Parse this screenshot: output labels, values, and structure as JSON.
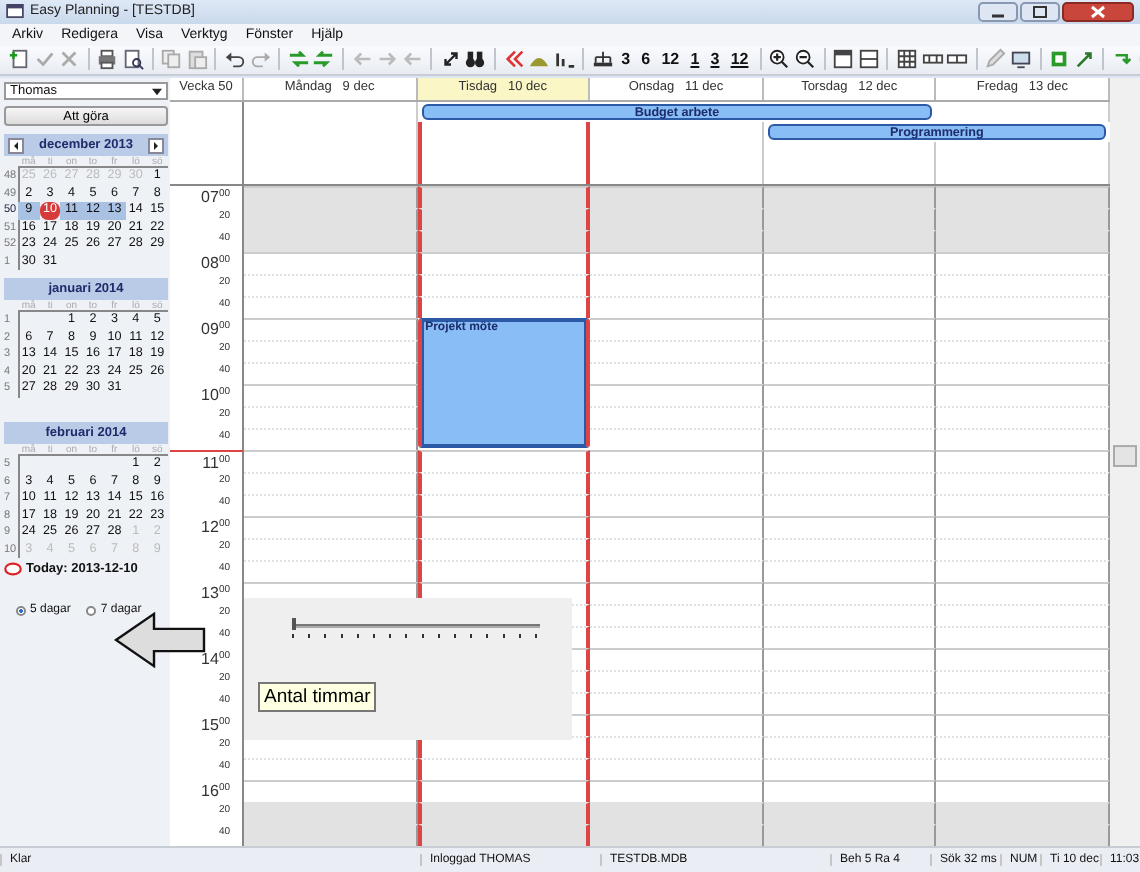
{
  "window": {
    "title": "Easy Planning - [TESTDB]"
  },
  "menu": [
    "Arkiv",
    "Redigera",
    "Visa",
    "Verktyg",
    "Fönster",
    "Hjälp"
  ],
  "toolbar": {
    "text_buttons": [
      {
        "label": "3",
        "underlined": false
      },
      {
        "label": "6",
        "underlined": false
      },
      {
        "label": "12",
        "underlined": false
      },
      {
        "label": "1",
        "underlined": true
      },
      {
        "label": "3",
        "underlined": true
      },
      {
        "label": "12",
        "underlined": true
      }
    ]
  },
  "sidebar": {
    "user": "Thomas",
    "todo_button": "Att göra",
    "months": [
      {
        "title": "december 2013",
        "navigation": true,
        "weekdays": [
          "må",
          "ti",
          "on",
          "to",
          "fr",
          "lö",
          "sö"
        ],
        "weeks": [
          {
            "number": "48",
            "selected": false,
            "days": [
              {
                "label": "25",
                "outside": true,
                "today": false
              },
              {
                "label": "26",
                "outside": true,
                "today": false
              },
              {
                "label": "27",
                "outside": true,
                "today": false
              },
              {
                "label": "28",
                "outside": true,
                "today": false
              },
              {
                "label": "29",
                "outside": true,
                "today": false
              },
              {
                "label": "30",
                "outside": true,
                "today": false
              },
              {
                "label": "1",
                "outside": false,
                "today": false
              }
            ]
          },
          {
            "number": "49",
            "selected": false,
            "days": [
              {
                "label": "2",
                "outside": false,
                "today": false
              },
              {
                "label": "3",
                "outside": false,
                "today": false
              },
              {
                "label": "4",
                "outside": false,
                "today": false
              },
              {
                "label": "5",
                "outside": false,
                "today": false
              },
              {
                "label": "6",
                "outside": false,
                "today": false
              },
              {
                "label": "7",
                "outside": false,
                "today": false
              },
              {
                "label": "8",
                "outside": false,
                "today": false
              }
            ]
          },
          {
            "number": "50",
            "selected": true,
            "days": [
              {
                "label": "9",
                "outside": false,
                "today": false
              },
              {
                "label": "10",
                "outside": false,
                "today": true
              },
              {
                "label": "11",
                "outside": false,
                "today": false
              },
              {
                "label": "12",
                "outside": false,
                "today": false
              },
              {
                "label": "13",
                "outside": false,
                "today": false
              },
              {
                "label": "14",
                "outside": false,
                "today": false
              },
              {
                "label": "15",
                "outside": false,
                "today": false
              }
            ]
          },
          {
            "number": "51",
            "selected": false,
            "days": [
              {
                "label": "16",
                "outside": false,
                "today": false
              },
              {
                "label": "17",
                "outside": false,
                "today": false
              },
              {
                "label": "18",
                "outside": false,
                "today": false
              },
              {
                "label": "19",
                "outside": false,
                "today": false
              },
              {
                "label": "20",
                "outside": false,
                "today": false
              },
              {
                "label": "21",
                "outside": false,
                "today": false
              },
              {
                "label": "22",
                "outside": false,
                "today": false
              }
            ]
          },
          {
            "number": "52",
            "selected": false,
            "days": [
              {
                "label": "23",
                "outside": false,
                "today": false
              },
              {
                "label": "24",
                "outside": false,
                "today": false
              },
              {
                "label": "25",
                "outside": false,
                "today": false
              },
              {
                "label": "26",
                "outside": false,
                "today": false
              },
              {
                "label": "27",
                "outside": false,
                "today": false
              },
              {
                "label": "28",
                "outside": false,
                "today": false
              },
              {
                "label": "29",
                "outside": false,
                "today": false
              }
            ]
          },
          {
            "number": "1",
            "selected": false,
            "days": [
              {
                "label": "30",
                "outside": false,
                "today": false
              },
              {
                "label": "31",
                "outside": false,
                "today": false
              }
            ]
          }
        ]
      },
      {
        "title": "januari 2014",
        "navigation": false,
        "weekdays": [
          "må",
          "ti",
          "on",
          "to",
          "fr",
          "lö",
          "sö"
        ],
        "weeks": [
          {
            "number": "1",
            "selected": false,
            "days": [
              {
                "label": "1",
                "outside": false,
                "today": false
              },
              {
                "label": "2",
                "outside": false,
                "today": false
              },
              {
                "label": "3",
                "outside": false,
                "today": false
              },
              {
                "label": "4",
                "outside": false,
                "today": false
              },
              {
                "label": "5",
                "outside": false,
                "today": false
              }
            ]
          },
          {
            "number": "2",
            "selected": false,
            "days": [
              {
                "label": "6",
                "outside": false,
                "today": false
              },
              {
                "label": "7",
                "outside": false,
                "today": false
              },
              {
                "label": "8",
                "outside": false,
                "today": false
              },
              {
                "label": "9",
                "outside": false,
                "today": false
              },
              {
                "label": "10",
                "outside": false,
                "today": false
              },
              {
                "label": "11",
                "outside": false,
                "today": false
              },
              {
                "label": "12",
                "outside": false,
                "today": false
              }
            ]
          },
          {
            "number": "3",
            "selected": false,
            "days": [
              {
                "label": "13",
                "outside": false,
                "today": false
              },
              {
                "label": "14",
                "outside": false,
                "today": false
              },
              {
                "label": "15",
                "outside": false,
                "today": false
              },
              {
                "label": "16",
                "outside": false,
                "today": false
              },
              {
                "label": "17",
                "outside": false,
                "today": false
              },
              {
                "label": "18",
                "outside": false,
                "today": false
              },
              {
                "label": "19",
                "outside": false,
                "today": false
              }
            ]
          },
          {
            "number": "4",
            "selected": false,
            "days": [
              {
                "label": "20",
                "outside": false,
                "today": false
              },
              {
                "label": "21",
                "outside": false,
                "today": false
              },
              {
                "label": "22",
                "outside": false,
                "today": false
              },
              {
                "label": "23",
                "outside": false,
                "today": false
              },
              {
                "label": "24",
                "outside": false,
                "today": false
              },
              {
                "label": "25",
                "outside": false,
                "today": false
              },
              {
                "label": "26",
                "outside": false,
                "today": false
              }
            ]
          },
          {
            "number": "5",
            "selected": false,
            "days": [
              {
                "label": "27",
                "outside": false,
                "today": false
              },
              {
                "label": "28",
                "outside": false,
                "today": false
              },
              {
                "label": "29",
                "outside": false,
                "today": false
              },
              {
                "label": "30",
                "outside": false,
                "today": false
              },
              {
                "label": "31",
                "outside": false,
                "today": false
              }
            ]
          }
        ]
      },
      {
        "title": "februari 2014",
        "navigation": false,
        "weekdays": [
          "må",
          "ti",
          "on",
          "to",
          "fr",
          "lö",
          "sö"
        ],
        "weeks": [
          {
            "number": "5",
            "selected": false,
            "days": [
              {
                "label": "1",
                "outside": false,
                "today": false
              },
              {
                "label": "2",
                "outside": false,
                "today": false
              }
            ]
          },
          {
            "number": "6",
            "selected": false,
            "days": [
              {
                "label": "3",
                "outside": false,
                "today": false
              },
              {
                "label": "4",
                "outside": false,
                "today": false
              },
              {
                "label": "5",
                "outside": false,
                "today": false
              },
              {
                "label": "6",
                "outside": false,
                "today": false
              },
              {
                "label": "7",
                "outside": false,
                "today": false
              },
              {
                "label": "8",
                "outside": false,
                "today": false
              },
              {
                "label": "9",
                "outside": false,
                "today": false
              }
            ]
          },
          {
            "number": "7",
            "selected": false,
            "days": [
              {
                "label": "10",
                "outside": false,
                "today": false
              },
              {
                "label": "11",
                "outside": false,
                "today": false
              },
              {
                "label": "12",
                "outside": false,
                "today": false
              },
              {
                "label": "13",
                "outside": false,
                "today": false
              },
              {
                "label": "14",
                "outside": false,
                "today": false
              },
              {
                "label": "15",
                "outside": false,
                "today": false
              },
              {
                "label": "16",
                "outside": false,
                "today": false
              }
            ]
          },
          {
            "number": "8",
            "selected": false,
            "days": [
              {
                "label": "17",
                "outside": false,
                "today": false
              },
              {
                "label": "18",
                "outside": false,
                "today": false
              },
              {
                "label": "19",
                "outside": false,
                "today": false
              },
              {
                "label": "20",
                "outside": false,
                "today": false
              },
              {
                "label": "21",
                "outside": false,
                "today": false
              },
              {
                "label": "22",
                "outside": false,
                "today": false
              },
              {
                "label": "23",
                "outside": false,
                "today": false
              }
            ]
          },
          {
            "number": "9",
            "selected": false,
            "days": [
              {
                "label": "24",
                "outside": false,
                "today": false
              },
              {
                "label": "25",
                "outside": false,
                "today": false
              },
              {
                "label": "26",
                "outside": false,
                "today": false
              },
              {
                "label": "27",
                "outside": false,
                "today": false
              },
              {
                "label": "28",
                "outside": false,
                "today": false
              },
              {
                "label": "1",
                "outside": true,
                "today": false
              },
              {
                "label": "2",
                "outside": true,
                "today": false
              }
            ]
          },
          {
            "number": "10",
            "selected": false,
            "days": [
              {
                "label": "3",
                "outside": true,
                "today": false
              },
              {
                "label": "4",
                "outside": true,
                "today": false
              },
              {
                "label": "5",
                "outside": true,
                "today": false
              },
              {
                "label": "6",
                "outside": true,
                "today": false
              },
              {
                "label": "7",
                "outside": true,
                "today": false
              },
              {
                "label": "8",
                "outside": true,
                "today": false
              },
              {
                "label": "9",
                "outside": true,
                "today": false
              }
            ]
          }
        ]
      }
    ],
    "today_label": "Today: 2013-12-10",
    "view_options": [
      {
        "label": "5 dagar",
        "selected": true
      },
      {
        "label": "7 dagar",
        "selected": false
      }
    ]
  },
  "calendar": {
    "week_label": "Vecka 50",
    "days": [
      {
        "name": "Måndag",
        "date": "9 dec",
        "selected": false,
        "today": false
      },
      {
        "name": "Tisdag",
        "date": "10 dec",
        "selected": true,
        "today": true,
        "events": [
          {
            "title": "Projekt möte"
          }
        ]
      },
      {
        "name": "Onsdag",
        "date": "11 dec",
        "selected": false,
        "today": false
      },
      {
        "name": "Torsdag",
        "date": "12 dec",
        "selected": false,
        "today": false
      },
      {
        "name": "Fredag",
        "date": "13 dec",
        "selected": false,
        "today": false
      }
    ],
    "all_day_events": [
      {
        "title": "Budget arbete",
        "days": [
          false,
          true,
          true,
          true,
          false
        ]
      },
      {
        "title": "Programmering",
        "days": [
          false,
          false,
          false,
          true,
          true
        ]
      }
    ],
    "time_rows": [
      {
        "hour": "07",
        "minute": "00",
        "off_hours": true,
        "now": false,
        "booked": [
          false,
          false,
          false,
          false,
          false
        ]
      },
      {
        "minute": "20",
        "off_hours": true,
        "now": false,
        "booked": [
          false,
          false,
          false,
          false,
          false
        ]
      },
      {
        "minute": "40",
        "off_hours": true,
        "now": false,
        "booked": [
          false,
          false,
          false,
          false,
          false
        ]
      },
      {
        "hour": "08",
        "minute": "00",
        "off_hours": false,
        "now": false,
        "booked": [
          false,
          false,
          false,
          false,
          false
        ]
      },
      {
        "minute": "20",
        "off_hours": false,
        "now": false,
        "booked": [
          false,
          false,
          false,
          false,
          false
        ]
      },
      {
        "minute": "40",
        "off_hours": false,
        "now": false,
        "booked": [
          false,
          false,
          false,
          false,
          false
        ]
      },
      {
        "hour": "09",
        "minute": "00",
        "off_hours": false,
        "now": false,
        "booked": [
          false,
          true,
          false,
          false,
          false
        ]
      },
      {
        "minute": "20",
        "off_hours": false,
        "now": false,
        "booked": [
          false,
          true,
          false,
          false,
          false
        ]
      },
      {
        "minute": "40",
        "off_hours": false,
        "now": false,
        "booked": [
          false,
          true,
          false,
          false,
          false
        ]
      },
      {
        "hour": "10",
        "minute": "00",
        "off_hours": false,
        "now": false,
        "booked": [
          false,
          true,
          false,
          false,
          false
        ]
      },
      {
        "minute": "20",
        "off_hours": false,
        "now": false,
        "booked": [
          false,
          true,
          false,
          false,
          false
        ]
      },
      {
        "minute": "40",
        "off_hours": false,
        "now": false,
        "booked": [
          false,
          true,
          false,
          false,
          false
        ]
      },
      {
        "hour": "11",
        "minute": "00",
        "off_hours": false,
        "now": true,
        "booked": [
          false,
          false,
          false,
          false,
          false
        ]
      },
      {
        "minute": "20",
        "off_hours": false,
        "now": false,
        "booked": [
          false,
          false,
          false,
          false,
          false
        ]
      },
      {
        "minute": "40",
        "off_hours": false,
        "now": false,
        "booked": [
          false,
          false,
          false,
          false,
          false
        ]
      },
      {
        "hour": "12",
        "minute": "00",
        "off_hours": false,
        "now": false,
        "booked": [
          false,
          false,
          false,
          false,
          false
        ]
      },
      {
        "minute": "20",
        "off_hours": false,
        "now": false,
        "booked": [
          false,
          false,
          false,
          false,
          false
        ]
      },
      {
        "minute": "40",
        "off_hours": false,
        "now": false,
        "booked": [
          false,
          false,
          false,
          false,
          false
        ]
      },
      {
        "hour": "13",
        "minute": "00",
        "off_hours": false,
        "now": false,
        "booked": [
          false,
          false,
          false,
          false,
          false
        ]
      },
      {
        "minute": "20",
        "off_hours": false,
        "now": false,
        "booked": [
          false,
          false,
          false,
          false,
          false
        ]
      },
      {
        "minute": "40",
        "off_hours": false,
        "now": false,
        "booked": [
          false,
          false,
          false,
          false,
          false
        ]
      },
      {
        "hour": "14",
        "minute": "00",
        "off_hours": false,
        "now": false,
        "booked": [
          false,
          false,
          false,
          false,
          false
        ]
      },
      {
        "minute": "20",
        "off_hours": false,
        "now": false,
        "booked": [
          false,
          false,
          false,
          false,
          false
        ]
      },
      {
        "minute": "40",
        "off_hours": false,
        "now": false,
        "booked": [
          false,
          false,
          false,
          false,
          false
        ]
      },
      {
        "hour": "15",
        "minute": "00",
        "off_hours": false,
        "now": false,
        "booked": [
          false,
          false,
          false,
          false,
          false
        ]
      },
      {
        "minute": "20",
        "off_hours": false,
        "now": false,
        "booked": [
          false,
          false,
          false,
          false,
          false
        ]
      },
      {
        "minute": "40",
        "off_hours": false,
        "now": false,
        "booked": [
          false,
          false,
          false,
          false,
          false
        ]
      },
      {
        "hour": "16",
        "minute": "00",
        "off_hours": false,
        "now": false,
        "booked": [
          false,
          false,
          false,
          false,
          false
        ]
      },
      {
        "minute": "20",
        "off_hours": true,
        "now": false,
        "booked": [
          false,
          false,
          false,
          false,
          false
        ]
      },
      {
        "minute": "40",
        "off_hours": true,
        "now": false,
        "booked": [
          false,
          false,
          false,
          false,
          false
        ]
      }
    ]
  },
  "hours_slider": {
    "level": 0,
    "tooltip": "Antal timmar"
  },
  "status_bar": [
    "Klar",
    "Inloggad THOMAS",
    "TESTDB.MDB",
    "Beh 5 Ra 4",
    "Sök 32 ms",
    "NUM",
    "Ti 10 dec",
    "11:03"
  ]
}
